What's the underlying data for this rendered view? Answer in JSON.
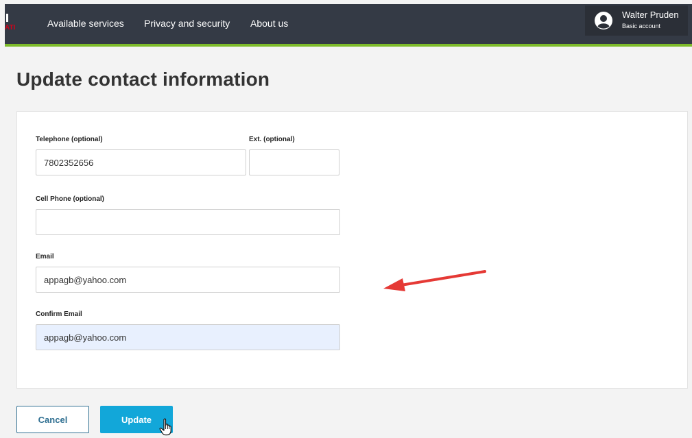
{
  "header": {
    "logo_fragment": "ATI",
    "nav": [
      {
        "label": "Available services"
      },
      {
        "label": "Privacy and security"
      },
      {
        "label": "About us"
      }
    ],
    "account": {
      "name": "Walter Pruden",
      "type": "Basic account",
      "icon": "user-avatar-icon"
    }
  },
  "page": {
    "title": "Update contact information"
  },
  "form": {
    "telephone": {
      "label": "Telephone (optional)",
      "value": "7802352656"
    },
    "ext": {
      "label": "Ext. (optional)",
      "value": ""
    },
    "cell_phone": {
      "label": "Cell Phone (optional)",
      "value": ""
    },
    "email": {
      "label": "Email",
      "value": "appagb@yahoo.com"
    },
    "confirm_email": {
      "label": "Confirm Email",
      "value": "appagb@yahoo.com"
    }
  },
  "actions": {
    "cancel_label": "Cancel",
    "update_label": "Update"
  },
  "colors": {
    "header_bg": "#343a45",
    "accent_green": "#7dbb2a",
    "update_blue": "#12a7d9",
    "cancel_border": "#2f6f91",
    "annotation_red": "#e53935",
    "autofill_bg": "#e8f0fe"
  }
}
